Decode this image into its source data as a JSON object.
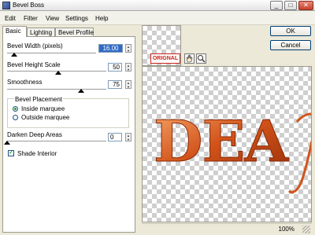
{
  "window": {
    "title": "Bevel Boss",
    "minimize": "_",
    "maximize": "□",
    "close": "✕"
  },
  "menu": [
    "Edit",
    "Filter",
    "View",
    "Settings",
    "Help"
  ],
  "tabs": [
    "Basic",
    "Lighting",
    "Bevel Profile"
  ],
  "basic": {
    "bevel_width": {
      "label": "Bevel Width (pixels)",
      "value": "16.00"
    },
    "bevel_height": {
      "label": "Bevel Height Scale",
      "value": "50"
    },
    "smoothness": {
      "label": "Smoothness",
      "value": "75"
    },
    "placement": {
      "label": "Bevel Placement",
      "inside": "Inside marquee",
      "outside": "Outside marquee",
      "selected": "inside"
    },
    "darken": {
      "label": "Darken Deep Areas",
      "value": "0"
    },
    "shade_interior": {
      "label": "Shade Interior",
      "checked": true
    }
  },
  "buttons": {
    "ok": "OK",
    "cancel": "Cancel"
  },
  "preview": {
    "original_label": "ORIGNAL",
    "zoom": "100%",
    "text": "DEA",
    "text_color": "#d2531a"
  }
}
